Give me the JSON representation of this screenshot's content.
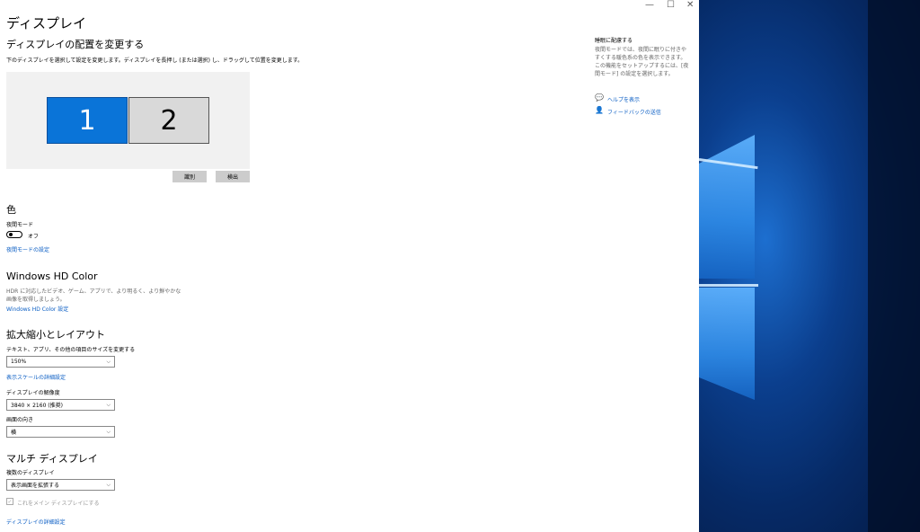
{
  "window_controls": {
    "minimize": "—",
    "maximize": "☐",
    "close": "✕"
  },
  "page": {
    "title": "ディスプレイ"
  },
  "arrange": {
    "heading": "ディスプレイの配置を変更する",
    "instruction": "下のディスプレイを選択して設定を変更します。ディスプレイを長押し (または選択) し、ドラッグして位置を変更します。",
    "monitors": [
      "1",
      "2"
    ],
    "identify_label": "識別",
    "detect_label": "検出"
  },
  "color": {
    "heading": "色",
    "night_light_label": "夜間モード",
    "night_light_state": "オフ",
    "night_light_link": "夜間モードの設定"
  },
  "hdr": {
    "heading": "Windows HD Color",
    "description": "HDR に対応したビデオ、ゲーム、アプリで、より明るく、より鮮やかな画像を取得しましょう。",
    "link": "Windows HD Color 設定"
  },
  "scale": {
    "heading": "拡大縮小とレイアウト",
    "size_label": "テキスト、アプリ、その他の項目のサイズを変更する",
    "size_value": "150%",
    "advanced_link": "表示スケールの詳細設定",
    "resolution_label": "ディスプレイの解像度",
    "resolution_value": "3840 × 2160 (推奨)",
    "orientation_label": "画面の向き",
    "orientation_value": "横"
  },
  "multi": {
    "heading": "マルチ ディスプレイ",
    "multiple_label": "複数のディスプレイ",
    "multiple_value": "表示画面を拡張する",
    "main_checkbox_label": "これをメイン ディスプレイにする",
    "advanced_link": "ディスプレイの詳細設定"
  },
  "sidebar": {
    "heading": "睡眠に配慮する",
    "description": "夜間モードでは、夜間に眠りに付きやすくする暖色系の色を表示できます。この機能をセットアップするには、[夜間モード] の設定を選択します。",
    "help_link": "ヘルプを表示",
    "feedback_link": "フィードバックの送信"
  }
}
